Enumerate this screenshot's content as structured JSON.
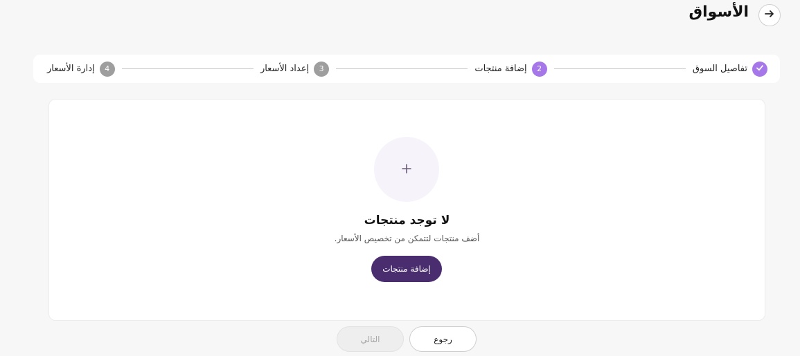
{
  "header": {
    "title": "الأسواق",
    "back_icon": "arrow-right-icon"
  },
  "stepper": {
    "steps": [
      {
        "number": "",
        "label": "تفاصيل السوق",
        "status": "done",
        "icon": "check-icon"
      },
      {
        "number": "2",
        "label": "إضافة منتجات",
        "status": "active"
      },
      {
        "number": "3",
        "label": "إعداد الأسعار",
        "status": "pending"
      },
      {
        "number": "4",
        "label": "إدارة الأسعار",
        "status": "pending"
      }
    ]
  },
  "empty_state": {
    "icon": "plus-icon",
    "title": "لا توجد منتجات",
    "subtitle": "أضف منتجات لتتمكن من تخصيص الأسعار.",
    "button_label": "إضافة منتجات"
  },
  "footer": {
    "back_label": "رجوع",
    "next_label": "التالي"
  },
  "colors": {
    "accent": "#a577e8",
    "primary_button": "#4a2d6e",
    "pending_step": "#9e9e9e",
    "background": "#f7f7f7"
  }
}
